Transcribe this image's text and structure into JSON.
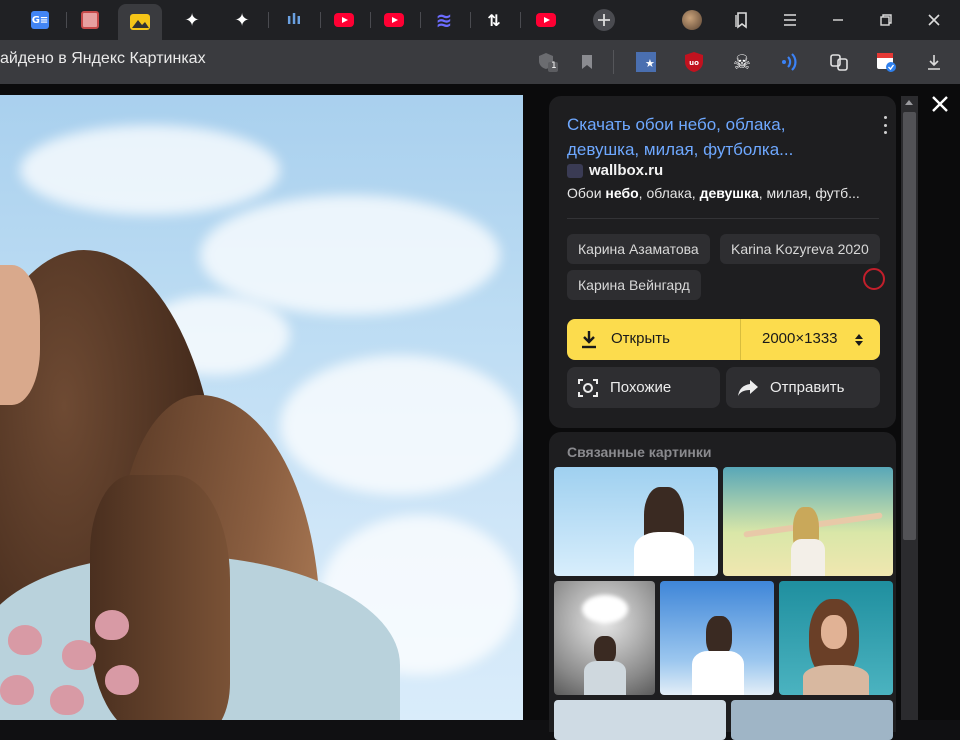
{
  "tabs": [
    {
      "name": "google-translate",
      "color": "#4285f4",
      "text": "G≡"
    },
    {
      "name": "app-grid",
      "color": "#e8a0a0",
      "text": ""
    },
    {
      "name": "yandex-images",
      "color": "#f5c518",
      "text": ""
    },
    {
      "name": "sparkle-1",
      "color": "#ffffff",
      "text": "✦"
    },
    {
      "name": "sparkle-2",
      "color": "#ffffff",
      "text": "✦"
    },
    {
      "name": "multicolor",
      "color": "#6aa0e0",
      "text": "ılı"
    },
    {
      "name": "youtube-1",
      "color": "#ff0033",
      "text": ""
    },
    {
      "name": "youtube-2",
      "color": "#ff0033",
      "text": ""
    },
    {
      "name": "stack-app",
      "color": "#6c6cff",
      "text": "≋"
    },
    {
      "name": "code-app",
      "color": "#ffffff",
      "text": "⇅"
    },
    {
      "name": "youtube-3",
      "color": "#ff0033",
      "text": ""
    }
  ],
  "toolbar": {
    "page_title": "айдено в Яндекс Картинках",
    "badge_count": "1"
  },
  "result": {
    "title": "Скачать обои небо, облака, девушка, милая, футболка...",
    "domain": "wallbox.ru",
    "snippet_parts": [
      {
        "t": "Обои ",
        "b": false
      },
      {
        "t": "небо",
        "b": true
      },
      {
        "t": ", облака, ",
        "b": false
      },
      {
        "t": "девушка",
        "b": true
      },
      {
        "t": ", милая, футб...",
        "b": false
      }
    ],
    "tags": [
      "Карина Азаматова",
      "Karina Kozyreva 2020",
      "Карина Вейнгард"
    ],
    "open_label": "Открыть",
    "size_label": "2000×1333",
    "similar_label": "Похожие",
    "share_label": "Отправить"
  },
  "related": {
    "title": "Связанные картинки"
  },
  "colors": {
    "accent_yellow": "#fcdc4d",
    "link_blue": "#6ea8ff",
    "panel_bg": "#1e1e20"
  }
}
